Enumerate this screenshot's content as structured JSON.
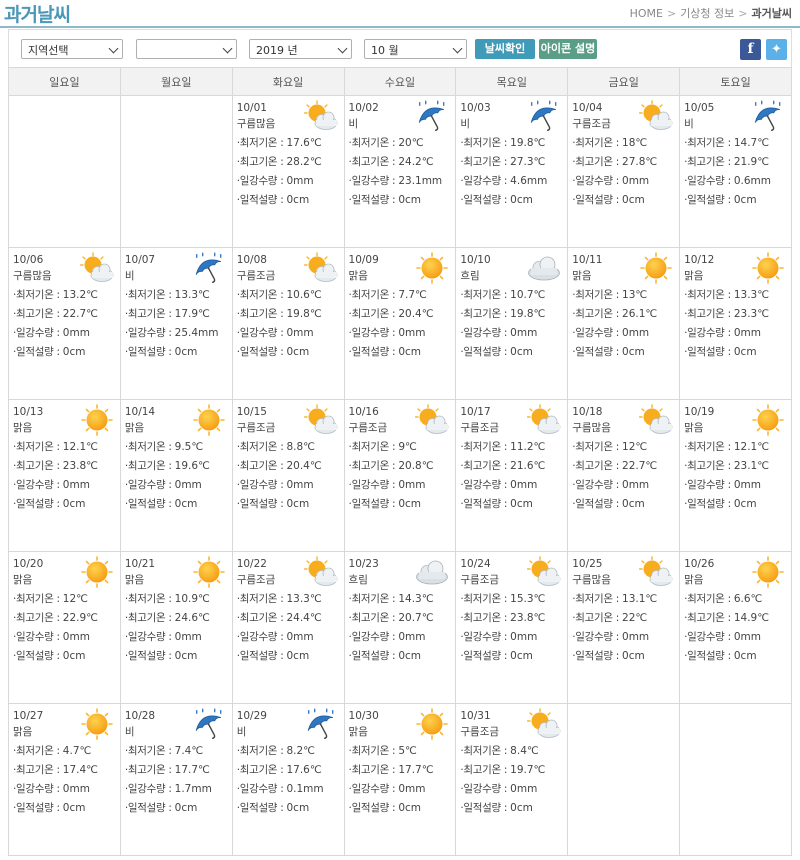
{
  "header": {
    "title": "과거날씨",
    "breadcrumb": [
      "HOME",
      "기상청 정보",
      "과거날씨"
    ]
  },
  "toolbar": {
    "region_select": "지역선택",
    "subregion_select": "",
    "year_select": "2019 년",
    "month_select": "10 월",
    "confirm_button": "날씨확인",
    "icon_desc_button": "아이콘 설명"
  },
  "labels": {
    "min_temp": "·최저기온 : ",
    "max_temp": "·최고기온 : ",
    "rain": "·일강수량 : ",
    "snow": "·일적설량 : "
  },
  "weekdays": [
    "일요일",
    "월요일",
    "화요일",
    "수요일",
    "목요일",
    "금요일",
    "토요일"
  ],
  "colors": {
    "accent": "#4a98b8",
    "sun": "#f5a623",
    "umbrella": "#3b7cc4",
    "cloud": "#d0d8de"
  },
  "weeks": [
    [
      null,
      null,
      {
        "date": "10/01",
        "cond": "구름많음",
        "icon": "sun-cloud-icon",
        "min": "17.6℃",
        "max": "28.2℃",
        "rain": "0mm",
        "snow": "0cm"
      },
      {
        "date": "10/02",
        "cond": "비",
        "icon": "umbrella-rain-icon",
        "min": "20℃",
        "max": "24.2℃",
        "rain": "23.1mm",
        "snow": "0cm"
      },
      {
        "date": "10/03",
        "cond": "비",
        "icon": "umbrella-rain-icon",
        "min": "19.8℃",
        "max": "27.3℃",
        "rain": "4.6mm",
        "snow": "0cm"
      },
      {
        "date": "10/04",
        "cond": "구름조금",
        "icon": "sun-cloud-icon",
        "min": "18℃",
        "max": "27.8℃",
        "rain": "0mm",
        "snow": "0cm"
      },
      {
        "date": "10/05",
        "cond": "비",
        "icon": "umbrella-rain-icon",
        "min": "14.7℃",
        "max": "21.9℃",
        "rain": "0.6mm",
        "snow": "0cm"
      }
    ],
    [
      {
        "date": "10/06",
        "cond": "구름많음",
        "icon": "sun-cloud-icon",
        "min": "13.2℃",
        "max": "22.7℃",
        "rain": "0mm",
        "snow": "0cm"
      },
      {
        "date": "10/07",
        "cond": "비",
        "icon": "umbrella-rain-icon",
        "min": "13.3℃",
        "max": "17.9℃",
        "rain": "25.4mm",
        "snow": "0cm"
      },
      {
        "date": "10/08",
        "cond": "구름조금",
        "icon": "sun-cloud-icon",
        "min": "10.6℃",
        "max": "19.8℃",
        "rain": "0mm",
        "snow": "0cm"
      },
      {
        "date": "10/09",
        "cond": "맑음",
        "icon": "sun-icon",
        "min": "7.7℃",
        "max": "20.4℃",
        "rain": "0mm",
        "snow": "0cm"
      },
      {
        "date": "10/10",
        "cond": "흐림",
        "icon": "cloud-icon",
        "min": "10.7℃",
        "max": "19.8℃",
        "rain": "0mm",
        "snow": "0cm"
      },
      {
        "date": "10/11",
        "cond": "맑음",
        "icon": "sun-icon",
        "min": "13℃",
        "max": "26.1℃",
        "rain": "0mm",
        "snow": "0cm"
      },
      {
        "date": "10/12",
        "cond": "맑음",
        "icon": "sun-icon",
        "min": "13.3℃",
        "max": "23.3℃",
        "rain": "0mm",
        "snow": "0cm"
      }
    ],
    [
      {
        "date": "10/13",
        "cond": "맑음",
        "icon": "sun-icon",
        "min": "12.1℃",
        "max": "23.8℃",
        "rain": "0mm",
        "snow": "0cm"
      },
      {
        "date": "10/14",
        "cond": "맑음",
        "icon": "sun-icon",
        "min": "9.5℃",
        "max": "19.6℃",
        "rain": "0mm",
        "snow": "0cm"
      },
      {
        "date": "10/15",
        "cond": "구름조금",
        "icon": "sun-cloud-icon",
        "min": "8.8℃",
        "max": "20.4℃",
        "rain": "0mm",
        "snow": "0cm"
      },
      {
        "date": "10/16",
        "cond": "구름조금",
        "icon": "sun-cloud-icon",
        "min": "9℃",
        "max": "20.8℃",
        "rain": "0mm",
        "snow": "0cm"
      },
      {
        "date": "10/17",
        "cond": "구름조금",
        "icon": "sun-cloud-icon",
        "min": "11.2℃",
        "max": "21.6℃",
        "rain": "0mm",
        "snow": "0cm"
      },
      {
        "date": "10/18",
        "cond": "구름많음",
        "icon": "sun-cloud-icon",
        "min": "12℃",
        "max": "22.7℃",
        "rain": "0mm",
        "snow": "0cm"
      },
      {
        "date": "10/19",
        "cond": "맑음",
        "icon": "sun-icon",
        "min": "12.1℃",
        "max": "23.1℃",
        "rain": "0mm",
        "snow": "0cm"
      }
    ],
    [
      {
        "date": "10/20",
        "cond": "맑음",
        "icon": "sun-icon",
        "min": "12℃",
        "max": "22.9℃",
        "rain": "0mm",
        "snow": "0cm"
      },
      {
        "date": "10/21",
        "cond": "맑음",
        "icon": "sun-icon",
        "min": "10.9℃",
        "max": "24.6℃",
        "rain": "0mm",
        "snow": "0cm"
      },
      {
        "date": "10/22",
        "cond": "구름조금",
        "icon": "sun-cloud-icon",
        "min": "13.3℃",
        "max": "24.4℃",
        "rain": "0mm",
        "snow": "0cm"
      },
      {
        "date": "10/23",
        "cond": "흐림",
        "icon": "cloud-icon",
        "min": "14.3℃",
        "max": "20.7℃",
        "rain": "0mm",
        "snow": "0cm"
      },
      {
        "date": "10/24",
        "cond": "구름조금",
        "icon": "sun-cloud-icon",
        "min": "15.3℃",
        "max": "23.8℃",
        "rain": "0mm",
        "snow": "0cm"
      },
      {
        "date": "10/25",
        "cond": "구름많음",
        "icon": "sun-cloud-icon",
        "min": "13.1℃",
        "max": "22℃",
        "rain": "0mm",
        "snow": "0cm"
      },
      {
        "date": "10/26",
        "cond": "맑음",
        "icon": "sun-icon",
        "min": "6.6℃",
        "max": "14.9℃",
        "rain": "0mm",
        "snow": "0cm"
      }
    ],
    [
      {
        "date": "10/27",
        "cond": "맑음",
        "icon": "sun-icon",
        "min": "4.7℃",
        "max": "17.4℃",
        "rain": "0mm",
        "snow": "0cm"
      },
      {
        "date": "10/28",
        "cond": "비",
        "icon": "umbrella-rain-icon",
        "min": "7.4℃",
        "max": "17.7℃",
        "rain": "1.7mm",
        "snow": "0cm"
      },
      {
        "date": "10/29",
        "cond": "비",
        "icon": "umbrella-rain-icon",
        "min": "8.2℃",
        "max": "17.6℃",
        "rain": "0.1mm",
        "snow": "0cm"
      },
      {
        "date": "10/30",
        "cond": "맑음",
        "icon": "sun-icon",
        "min": "5℃",
        "max": "17.7℃",
        "rain": "0mm",
        "snow": "0cm"
      },
      {
        "date": "10/31",
        "cond": "구름조금",
        "icon": "sun-cloud-icon",
        "min": "8.4℃",
        "max": "19.7℃",
        "rain": "0mm",
        "snow": "0cm"
      },
      null,
      null
    ]
  ]
}
